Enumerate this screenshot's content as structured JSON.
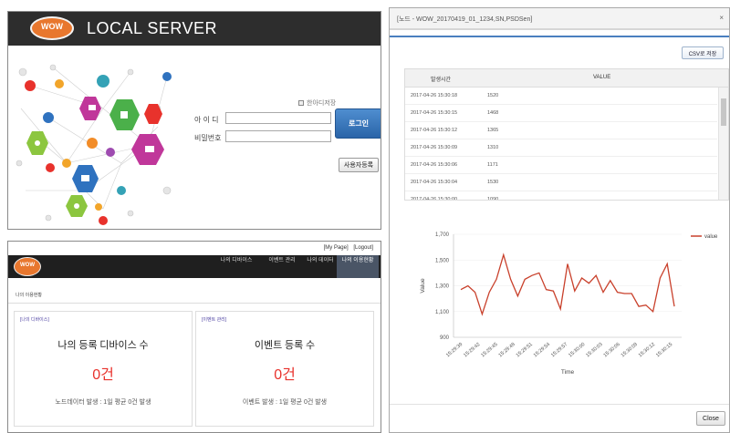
{
  "login": {
    "logo_text": "WOW",
    "title": "LOCAL SERVER",
    "remember_label": "한아디저장",
    "id_label": "아 이 디",
    "password_label": "비밀번호",
    "login_button": "로그인",
    "register_button": "사용자등록"
  },
  "dashboard": {
    "top_links": [
      "[My Page]",
      "[Logout]"
    ],
    "logo_text": "WOW",
    "nav": [
      {
        "label": "나의 디바이스",
        "active": false
      },
      {
        "label": "이벤트 관리",
        "active": false
      },
      {
        "label": "나의 데이터",
        "active": false
      },
      {
        "label": "나의 이용현황",
        "active": true
      }
    ],
    "page_title": "나의 이용현황",
    "cards": [
      {
        "tag": "[나의 디바이스]",
        "title": "나의 등록 디바이스 수",
        "count": "0건",
        "foot": "노드데이터 발생 : 1일 평균 0건 발생"
      },
      {
        "tag": "[이벤트 관리]",
        "title": "이벤트 등록 수",
        "count": "0건",
        "foot": "이벤트 발생 : 1일 평균 0건 발생"
      }
    ]
  },
  "popup": {
    "title": "[노드 - WOW_20170419_01_1234,SN,PSDSen]",
    "close_icon": "x-icon",
    "csv_button": "CSV로 저장",
    "table": {
      "columns": [
        "발생시간",
        "VALUE"
      ],
      "rows": [
        [
          "2017-04-26 15:30:18",
          "1520"
        ],
        [
          "2017-04-26 15:30:15",
          "1468"
        ],
        [
          "2017-04-26 15:30:12",
          "1365"
        ],
        [
          "2017-04-26 15:30:09",
          "1310"
        ],
        [
          "2017-04-26 15:30:06",
          "1171"
        ],
        [
          "2017-04-26 15:30:04",
          "1530"
        ],
        [
          "2017-04-26 15:30:00",
          "1090"
        ]
      ]
    },
    "close_button": "Close"
  },
  "colors": {
    "line": "#c9412c",
    "accent": "#4a7fbf",
    "count_red": "#e8322c"
  },
  "chart_data": {
    "type": "line",
    "xlabel": "Time",
    "ylabel": "Value",
    "ylim": [
      900,
      1700
    ],
    "yticks": [
      "900",
      "1,100",
      "1,300",
      "1,500",
      "1,700"
    ],
    "xticks": [
      "15:29:39",
      "15:29:42",
      "15:29:45",
      "15:29:48",
      "15:29:51",
      "15:29:54",
      "15:29:57",
      "15:30:00",
      "15:30:03",
      "15:30:06",
      "15:30:09",
      "15:30:12",
      "15:30:15"
    ],
    "series": [
      {
        "name": "value",
        "values": [
          1270,
          1300,
          1250,
          1080,
          1250,
          1350,
          1540,
          1350,
          1220,
          1350,
          1380,
          1400,
          1270,
          1260,
          1120,
          1470,
          1260,
          1360,
          1320,
          1380,
          1250,
          1340,
          1250,
          1240,
          1240,
          1140,
          1150,
          1100,
          1360,
          1470,
          1140
        ]
      }
    ]
  }
}
